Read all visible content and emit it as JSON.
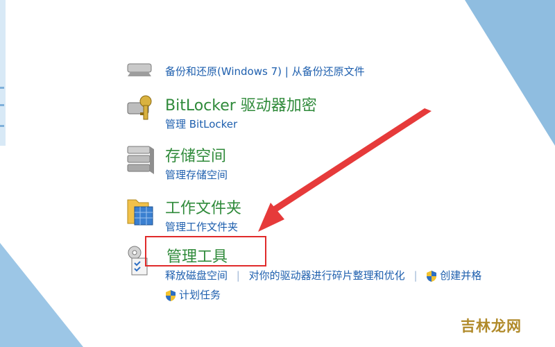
{
  "backup_links": {
    "text": "备份和还原(Windows 7)  |  从备份还原文件"
  },
  "bitlocker": {
    "title": "BitLocker 驱动器加密",
    "link": "管理 BitLocker"
  },
  "storage_spaces": {
    "title": "存储空间",
    "link": "管理存储空间"
  },
  "work_folders": {
    "title": "工作文件夹",
    "link": "管理工作文件夹"
  },
  "admin_tools": {
    "title": "管理工具",
    "links": [
      "释放磁盘空间",
      "对你的驱动器进行碎片整理和优化",
      "创建并格",
      "计划任务"
    ]
  },
  "watermark": {
    "text": "吉林龙网"
  },
  "colors": {
    "title_green": "#2f8a3a",
    "link_blue": "#1e5fae",
    "highlight_red": "#e02a2a"
  }
}
